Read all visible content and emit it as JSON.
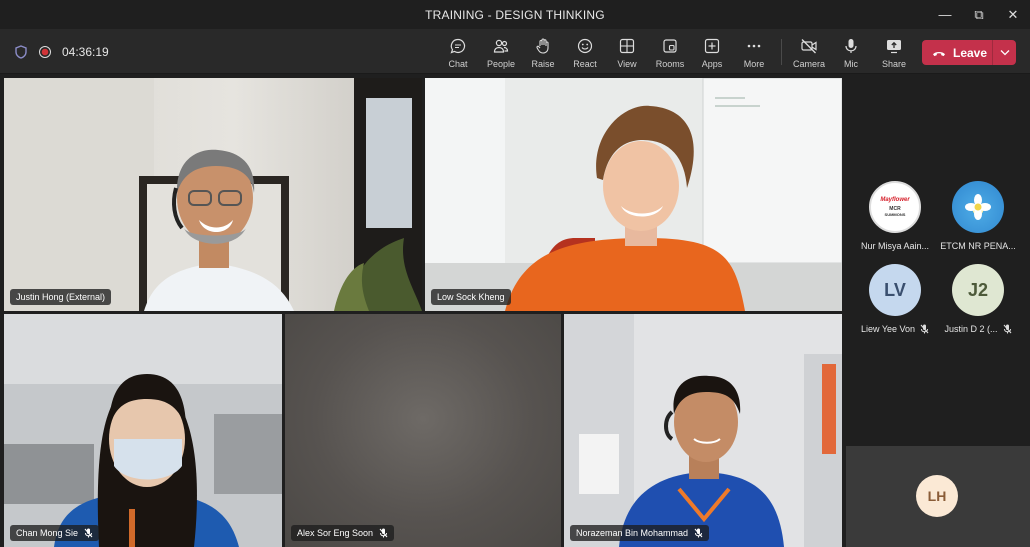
{
  "window": {
    "title": "TRAINING - DESIGN THINKING"
  },
  "status": {
    "timer": "04:36:19"
  },
  "toolbar": {
    "chat": "Chat",
    "people": "People",
    "raise": "Raise",
    "react": "React",
    "view": "View",
    "rooms": "Rooms",
    "apps": "Apps",
    "more": "More",
    "camera": "Camera",
    "mic": "Mic",
    "share": "Share",
    "leave": "Leave"
  },
  "participants": [
    {
      "name": "Justin Hong (External)"
    },
    {
      "name": "Low Sock Kheng"
    },
    {
      "name": "Chan Mong Sie"
    },
    {
      "name": "Alex Sor Eng Soon"
    },
    {
      "name": "Norazeman Bin Mohammad"
    }
  ],
  "sidebar": [
    {
      "name": "Nur Misya Aain...",
      "logo_line1": "Mayflower",
      "logo_line2": "MCR",
      "logo_line3": "SUMMONS"
    },
    {
      "name": "ETCM NR PENA..."
    },
    {
      "name": "Liew Yee Von",
      "initials": "LV"
    },
    {
      "name": "Justin D 2 (...",
      "initials": "J2"
    }
  ],
  "self": {
    "initials": "LH"
  },
  "colors": {
    "leave": "#c4314b",
    "accent": "#6264a7"
  }
}
